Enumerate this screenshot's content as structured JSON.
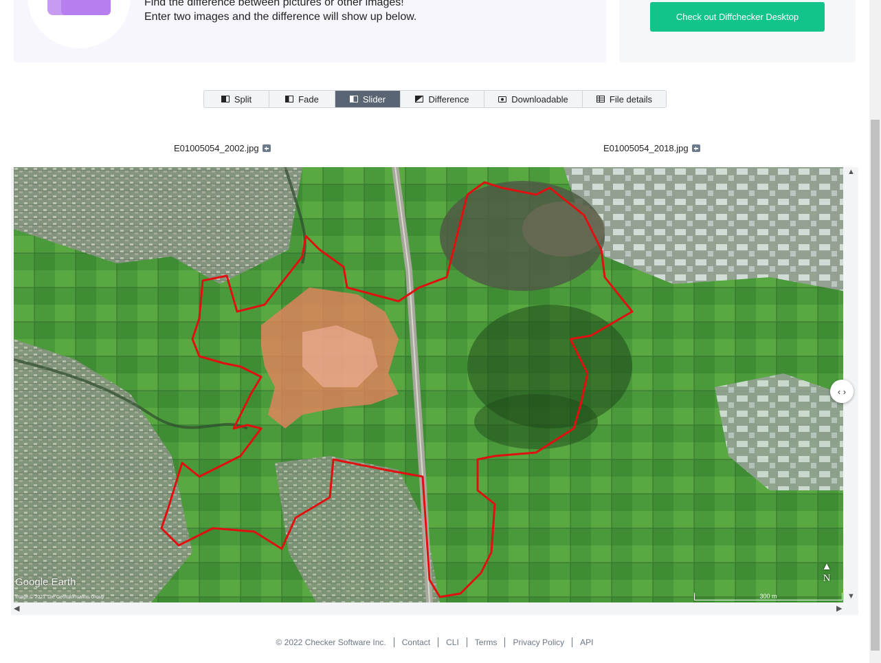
{
  "hero": {
    "line1": "Find the difference between pictures or other images!",
    "line2": "Enter two images and the difference will show up below."
  },
  "promo": {
    "button_label": "Check out Diffchecker Desktop"
  },
  "tabs": [
    {
      "label": "Split",
      "icon": "split-icon",
      "active": false
    },
    {
      "label": "Fade",
      "icon": "fade-icon",
      "active": false
    },
    {
      "label": "Slider",
      "icon": "slider-icon",
      "active": true
    },
    {
      "label": "Difference",
      "icon": "difference-icon",
      "active": false
    },
    {
      "label": "Downloadable",
      "icon": "camera-icon",
      "active": false
    },
    {
      "label": "File details",
      "icon": "table-icon",
      "active": false
    }
  ],
  "files": {
    "left": "E01005054_2002.jpg",
    "right": "E01005054_2018.jpg"
  },
  "map": {
    "logo": "Google Earth",
    "credit": "Image © 2021 The GeoInformation Group",
    "scale": "300 m",
    "north": "N",
    "boundary_color": "#e01010",
    "difference_color": "#f08060"
  },
  "footer": {
    "copyright": "© 2022 Checker Software Inc.",
    "links": [
      "Contact",
      "CLI",
      "Terms",
      "Privacy Policy",
      "API"
    ]
  }
}
